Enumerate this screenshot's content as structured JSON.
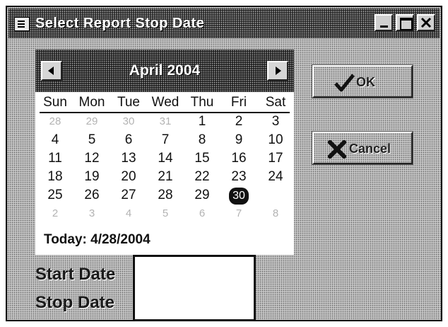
{
  "window": {
    "title": "Select Report Stop Date"
  },
  "calendar": {
    "month_label": "April 2004",
    "weekdays": [
      "Sun",
      "Mon",
      "Tue",
      "Wed",
      "Thu",
      "Fri",
      "Sat"
    ],
    "weeks": [
      [
        "28",
        "29",
        "30",
        "31",
        "1",
        "2",
        "3"
      ],
      [
        "4",
        "5",
        "6",
        "7",
        "8",
        "9",
        "10"
      ],
      [
        "11",
        "12",
        "13",
        "14",
        "15",
        "16",
        "17"
      ],
      [
        "18",
        "19",
        "20",
        "21",
        "22",
        "23",
        "24"
      ],
      [
        "25",
        "26",
        "27",
        "28",
        "29",
        "30",
        ""
      ],
      [
        "2",
        "3",
        "4",
        "5",
        "6",
        "7",
        "8"
      ]
    ],
    "selected_day": "30",
    "today_text": "Today: 4/28/2004"
  },
  "buttons": {
    "ok_label": "OK",
    "cancel_label": "Cancel"
  },
  "fields": {
    "start_label": "Start Date",
    "stop_label": "Stop Date",
    "date_value": ""
  },
  "colors": {
    "face": "#c4c4c4",
    "title": "#2a2a2a",
    "cancel_x": "#111111"
  }
}
